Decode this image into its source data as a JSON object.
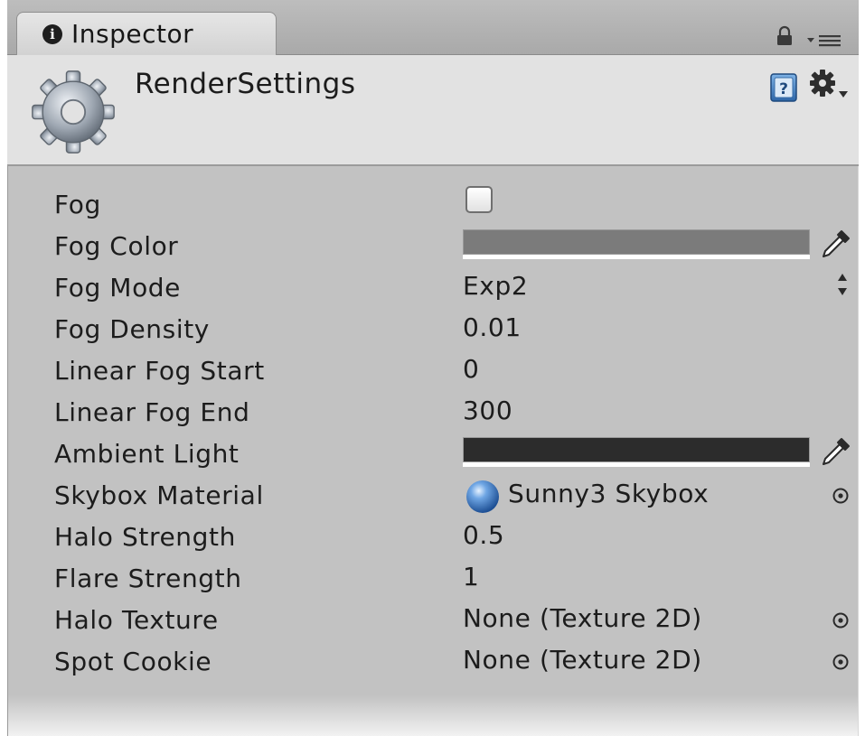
{
  "tab": {
    "label": "Inspector",
    "icon": "info-icon"
  },
  "header": {
    "title": "RenderSettings",
    "icon": "gear-icon"
  },
  "colors": {
    "fog_color": "#7b7b7b",
    "ambient_light": "#2c2c2c",
    "panel_bg": "#c2c2c2",
    "header_bg": "#e2e2e2"
  },
  "properties": [
    {
      "label": "Fog",
      "kind": "checkbox",
      "checked": false
    },
    {
      "label": "Fog Color",
      "kind": "color",
      "color": "#7b7b7b"
    },
    {
      "label": "Fog Mode",
      "kind": "enum",
      "value": "Exp2"
    },
    {
      "label": "Fog Density",
      "kind": "number",
      "value": "0.01"
    },
    {
      "label": "Linear Fog Start",
      "kind": "number",
      "value": "0"
    },
    {
      "label": "Linear Fog End",
      "kind": "number",
      "value": "300"
    },
    {
      "label": "Ambient Light",
      "kind": "color",
      "color": "#2c2c2c"
    },
    {
      "label": "Skybox Material",
      "kind": "object",
      "value": "Sunny3 Skybox",
      "icon": "sphere-icon"
    },
    {
      "label": "Halo Strength",
      "kind": "number",
      "value": "0.5"
    },
    {
      "label": "Flare Strength",
      "kind": "number",
      "value": "1"
    },
    {
      "label": "Halo Texture",
      "kind": "object",
      "value": "None (Texture 2D)"
    },
    {
      "label": "Spot Cookie",
      "kind": "object",
      "value": "None (Texture 2D)"
    }
  ]
}
